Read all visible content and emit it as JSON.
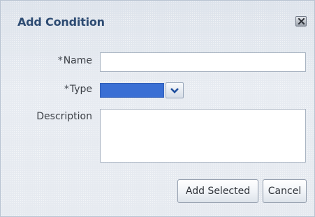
{
  "dialog": {
    "title": "Add Condition",
    "close_icon": "close-icon"
  },
  "form": {
    "name": {
      "required_marker": "*",
      "label": "Name",
      "value": ""
    },
    "type": {
      "required_marker": "*",
      "label": "Type",
      "selected_value": "",
      "dropdown_icon": "chevron-down-icon"
    },
    "description": {
      "label": "Description",
      "value": ""
    }
  },
  "buttons": {
    "add_selected": "Add Selected",
    "cancel": "Cancel"
  },
  "colors": {
    "title": "#2e4c73",
    "select_highlight": "#3a6fd4",
    "dialog_bg": "#e3e8ef"
  }
}
